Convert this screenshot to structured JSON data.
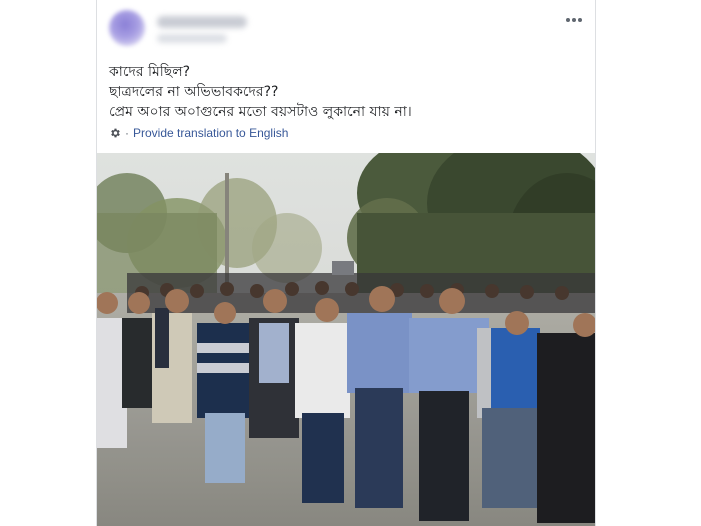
{
  "post": {
    "lines": [
      "কাদের মিছিল?",
      "ছাত্রদলের না অভিভাবকদের??",
      "প্রেম অ০ার অ০াগুনের মতো বয়সটাও লুকানো যায় না।"
    ],
    "translate_label": "Provide translation to English",
    "separator": "·"
  },
  "icons": {
    "avatar": "avatar-blurred",
    "more": "more-options-icon",
    "gear": "gear-icon",
    "photo": "protest-march-photo"
  },
  "colors": {
    "link": "#385898",
    "text": "#1c1e21",
    "border": "#dddfe2"
  }
}
